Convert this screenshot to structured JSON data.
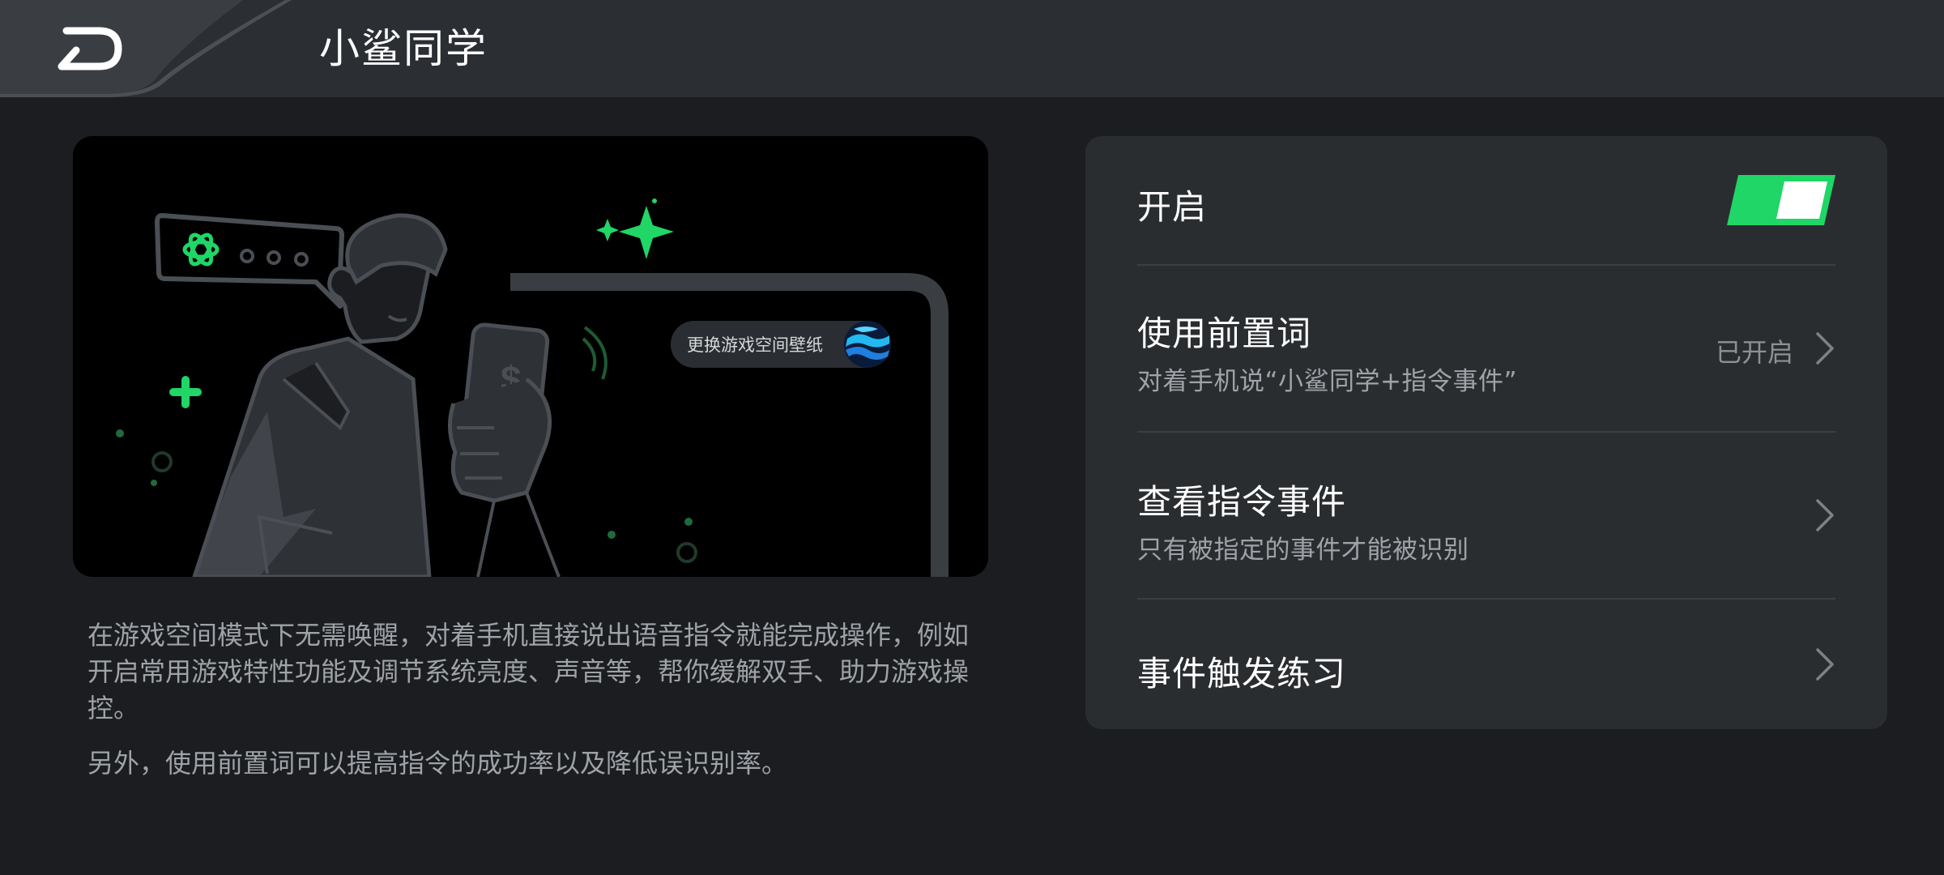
{
  "header": {
    "title": "小鲨同学"
  },
  "hero": {
    "wallpaper_button_label": "更换游戏空间壁纸"
  },
  "description": {
    "paragraph1": "在游戏空间模式下无需唤醒，对着手机直接说出语音指令就能完成操作，例如开启常用游戏特性功能及调节系统亮度、声音等，帮你缓解双手、助力游戏操控。",
    "paragraph2": "另外，使用前置词可以提高指令的成功率以及降低误识别率。"
  },
  "settings": {
    "enable": {
      "label": "开启",
      "on": true
    },
    "prefix_word": {
      "title": "使用前置词",
      "subtitle": "对着手机说“小鲨同学+指令事件”",
      "status": "已开启"
    },
    "view_commands": {
      "title": "查看指令事件",
      "subtitle": "只有被指定的事件才能被识别"
    },
    "practice": {
      "title": "事件触发练习"
    }
  },
  "colors": {
    "accent": "#1fd666",
    "background": "#1b1d20",
    "panel": "#2a2d30",
    "topbar": "#2b2f33"
  },
  "icons": {
    "back": "back-arrow-icon",
    "chevron": "chevron-right-icon",
    "toggle": "toggle-switch-icon"
  }
}
